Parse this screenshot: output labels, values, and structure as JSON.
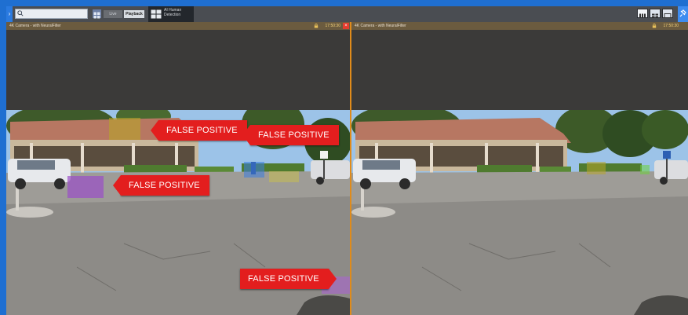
{
  "toolbar": {
    "live_label": "Live",
    "playback_label": "Playback",
    "ai_tab_label": "AI Human Detection"
  },
  "panes": [
    {
      "title": "4K Camera - with NeuralFilter",
      "time": "17:50:30"
    },
    {
      "title": "4K Camera - with NeuralFilter",
      "time": "17:50:30"
    }
  ],
  "annotations": {
    "false_positive_1": "FALSE POSITIVE",
    "false_positive_2": "FALSE POSITIVE",
    "false_positive_3": "FALSE POSITIVE",
    "false_positive_4": "FALSE POSITIVE"
  },
  "colors": {
    "accent_blue": "#1f6fd1",
    "tag_red": "#e31e1e",
    "pane_divider": "#e08b1a",
    "box_yellow": "#b8a52a",
    "box_purple": "#9a4fc8",
    "box_blue": "#3a7de0",
    "box_green": "#6cd23a"
  },
  "icons": [
    "search-icon",
    "grid-view-icon",
    "ai-detection-icon",
    "lock-icon",
    "close-icon",
    "layout-1x4-icon",
    "layout-2x2-icon",
    "layout-single-icon",
    "pin-icon"
  ]
}
